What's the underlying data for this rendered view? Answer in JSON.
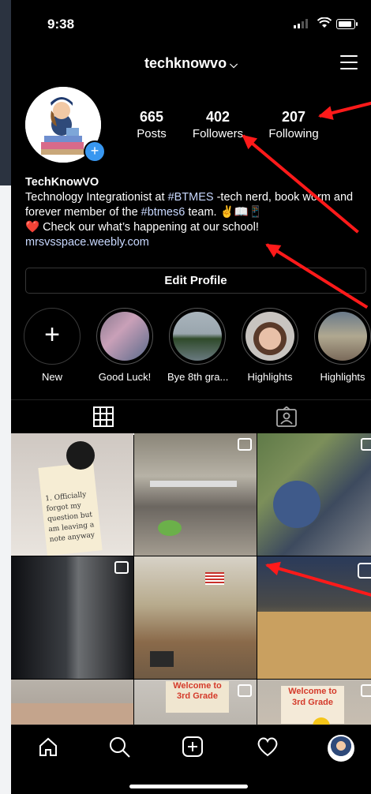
{
  "status_bar": {
    "time": "9:38"
  },
  "header": {
    "username": "techknowvo"
  },
  "stats": [
    {
      "count": "665",
      "label": "Posts"
    },
    {
      "count": "402",
      "label": "Followers"
    },
    {
      "count": "207",
      "label": "Following"
    }
  ],
  "bio": {
    "name": "TechKnowVO",
    "line1_pre": "Technology Integrationist at ",
    "tag1": "#BTMES",
    "line1_post": " -tech nerd, book worm and forever member of the ",
    "tag2": "#btmes6",
    "line1_end": " team. ✌️📖📱",
    "line2": "❤️ Check our what’s happening at our school!",
    "link": "mrsvsspace.weebly.com"
  },
  "edit_profile_label": "Edit Profile",
  "highlights": [
    {
      "label": "New"
    },
    {
      "label": "Good Luck!"
    },
    {
      "label": "Bye 8th gra..."
    },
    {
      "label": "Highlights"
    },
    {
      "label": "Highlights"
    }
  ],
  "grid_posts": [
    {
      "text": "1. Officially forgot my question but am leaving a note anyway"
    },
    {
      "text": ""
    },
    {
      "text": ""
    },
    {
      "text": ""
    },
    {
      "text": ""
    },
    {
      "text": ""
    },
    {
      "text": "Welcome to 3rd Grade"
    },
    {
      "text": "Welcome to 3rd Grade"
    },
    {
      "text": "Welcome to 3rd Grade"
    }
  ],
  "colors": {
    "accent": "#3897f0",
    "annotation_arrow": "#ff1a1a",
    "background": "#000000"
  },
  "icons": [
    "home-icon",
    "search-icon",
    "add-post-icon",
    "heart-icon",
    "profile-icon"
  ]
}
